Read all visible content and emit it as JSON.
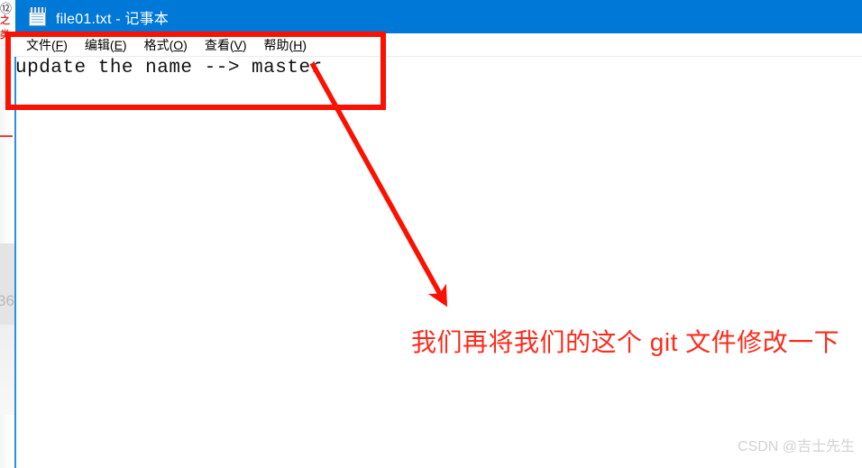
{
  "window": {
    "title": "file01.txt - 记事本",
    "icon": "notepad-icon",
    "titlebar_color": "#0078d7",
    "menu": [
      {
        "label": "文件",
        "accel": "F"
      },
      {
        "label": "编辑",
        "accel": "E"
      },
      {
        "label": "格式",
        "accel": "O"
      },
      {
        "label": "查看",
        "accel": "V"
      },
      {
        "label": "帮助",
        "accel": "H"
      }
    ],
    "document_text": "update the name --> master"
  },
  "background": {
    "partial_number": "36",
    "top_fragment_glyph": "⑫",
    "top_fragment_red": "之类"
  },
  "annotations": {
    "highlight_color": "#fa1100",
    "arrow_color": "#fa1100",
    "callout_text": "我们再将我们的这个 git 文件修改一下",
    "callout_color": "#fc2b1b"
  },
  "watermark": {
    "text": "CSDN @吉士先生",
    "color": "#d2d2d2"
  }
}
